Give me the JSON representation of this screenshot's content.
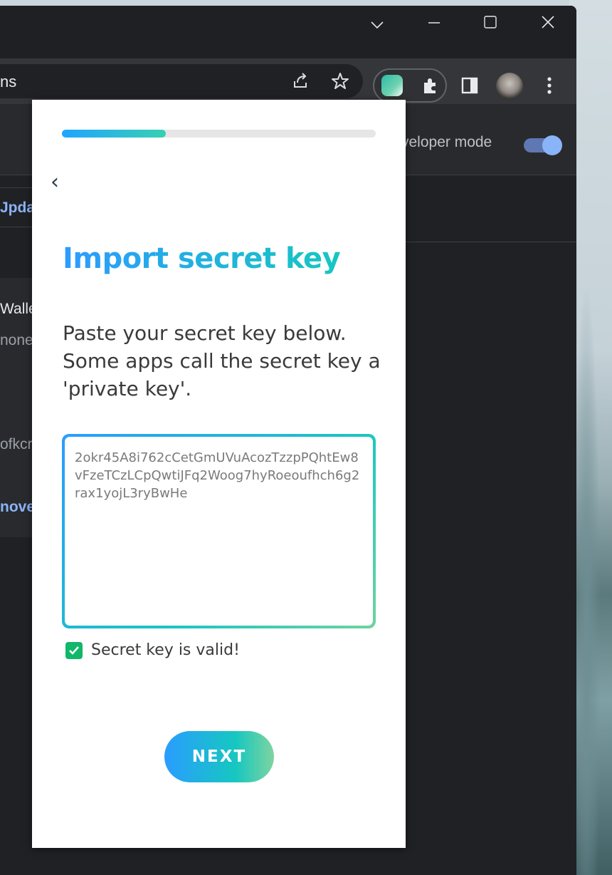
{
  "browser": {
    "url_partial": "ns",
    "window_controls": [
      "chevron-down",
      "minimize",
      "maximize",
      "close"
    ]
  },
  "page_behind": {
    "developer_mode_label": "veloper mode",
    "developer_mode_on": true,
    "update_label": "Jpdat",
    "card_title": "Walle",
    "card_line": "none",
    "card_id": "ofkcr",
    "remove_label": "nove"
  },
  "popup": {
    "progress": 0.33,
    "back_glyph": "‹",
    "title": "Import secret key",
    "description": "Paste your secret key below. Some apps call the secret key a 'private key'.",
    "secret_key_value": "2okr45A8i762cCetGmUVuAcozTzzpPQhtEw8vFzeTCzLCpQwtiJFq2Woog7hyRoeoufhch6g2rax1yojL3ryBwHe",
    "valid_message": "Secret key is valid!",
    "next_label": "NEXT"
  },
  "colors": {
    "accent_blue": "#2a9dff",
    "accent_teal": "#16c7c0",
    "valid_green": "#12b76a"
  }
}
